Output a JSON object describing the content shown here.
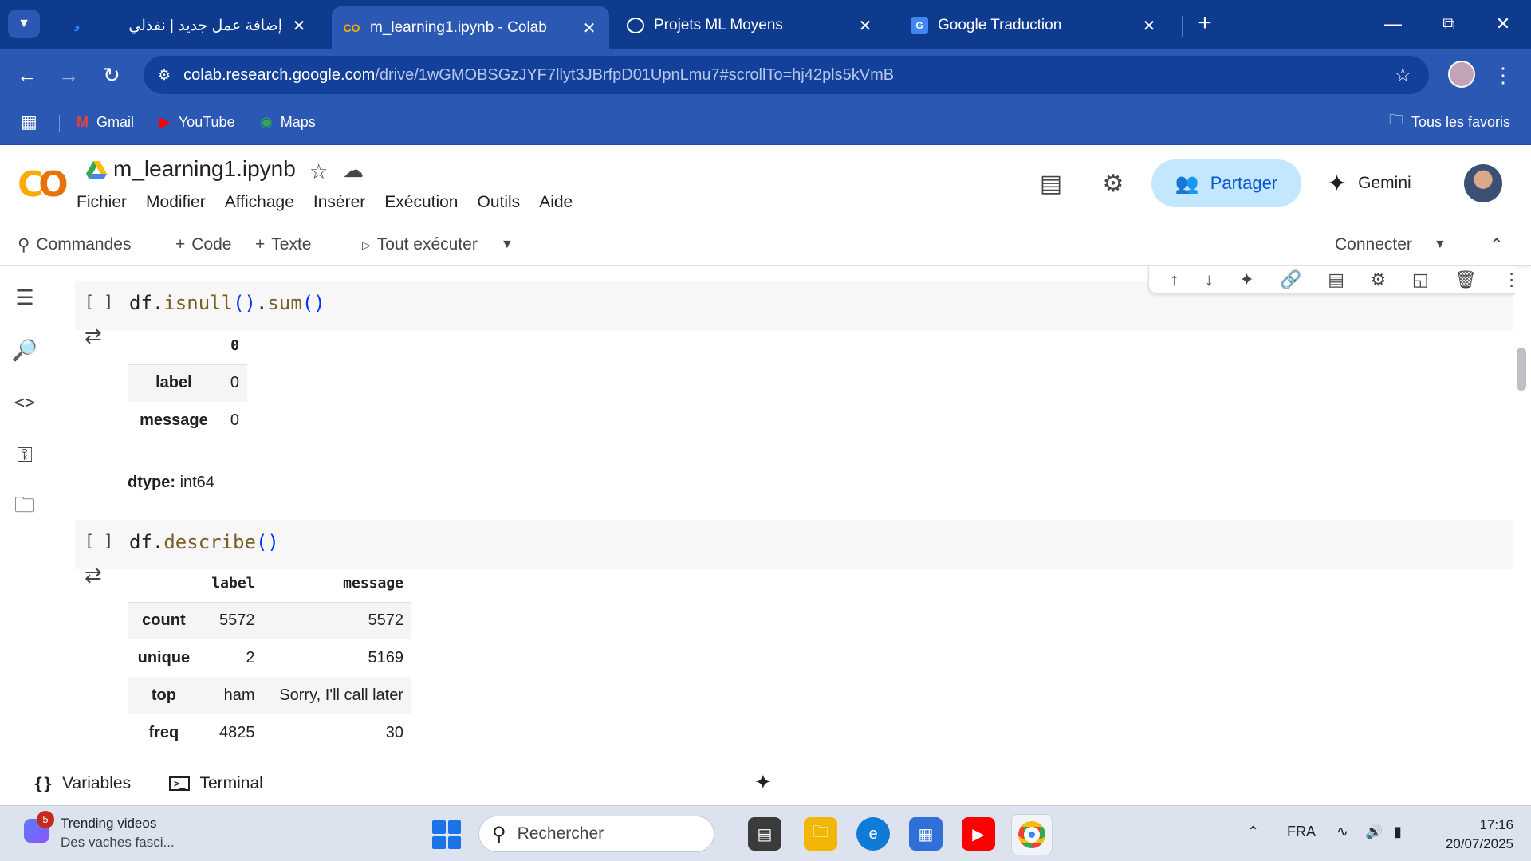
{
  "browser": {
    "tabs": [
      {
        "title": "إضافة عمل جديد | نفذلي",
        "active": false
      },
      {
        "title": "m_learning1.ipynb - Colab",
        "active": true
      },
      {
        "title": "Projets ML Moyens",
        "active": false
      },
      {
        "title": "Google Traduction",
        "active": false
      }
    ],
    "url_host": "colab.research.google.com",
    "url_path": "/drive/1wGMOBSGzJYF7llyt3JBrfpD01UpnLmu7#scrollTo=hj42pls5kVmB",
    "bookmarks": [
      "Gmail",
      "YouTube",
      "Maps"
    ],
    "all_bookmarks": "Tous les favoris"
  },
  "colab": {
    "logo": "CO",
    "notebook_title": "m_learning1.ipynb",
    "menu": [
      "Fichier",
      "Modifier",
      "Affichage",
      "Insérer",
      "Exécution",
      "Outils",
      "Aide"
    ],
    "share_label": "Partager",
    "gemini_label": "Gemini",
    "toolbar": {
      "commands": "Commandes",
      "code": "Code",
      "text": "Texte",
      "run_all": "Tout exécuter",
      "connect": "Connecter"
    },
    "cells": [
      {
        "bracket": "[ ]",
        "code_obj": "df.",
        "code_fn1": "isnull",
        "code_mid": ".",
        "code_fn2": "sum",
        "output": {
          "header": "0",
          "rows": [
            {
              "label": "label",
              "value": "0"
            },
            {
              "label": "message",
              "value": "0"
            }
          ],
          "dtype_label": "dtype:",
          "dtype_value": "int64"
        }
      },
      {
        "bracket": "[ ]",
        "code_obj": "df.",
        "code_fn1": "describe",
        "output": {
          "columns": [
            "label",
            "message"
          ],
          "rows": [
            {
              "index": "count",
              "label": "5572",
              "message": "5572"
            },
            {
              "index": "unique",
              "label": "2",
              "message": "5169"
            },
            {
              "index": "top",
              "label": "ham",
              "message": "Sorry, I'll call later"
            },
            {
              "index": "freq",
              "label": "4825",
              "message": "30"
            }
          ]
        }
      }
    ],
    "bottom": {
      "variables": "Variables",
      "terminal": "Terminal"
    }
  },
  "taskbar": {
    "widget_badge": "5",
    "widget_title": "Trending videos",
    "widget_sub": "Des vaches fasci...",
    "search_placeholder": "Rechercher",
    "lang": "FRA",
    "time": "17:16",
    "date": "20/07/2025"
  },
  "colors": {
    "chrome_dark": "#0f3b8f",
    "chrome": "#2b58b3",
    "share_bg": "#c2e7ff",
    "share_fg": "#0b57d0",
    "colab_orange": "#e8710a",
    "colab_yellow": "#f9ab00"
  }
}
